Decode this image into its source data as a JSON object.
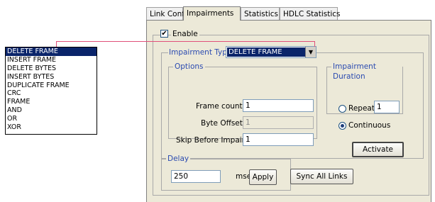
{
  "tabs": [
    "Link Config",
    "Impairments",
    "Statistics",
    "HDLC Statistics"
  ],
  "active_tab": "Impairments",
  "enable": {
    "label": "Enable",
    "checked": true
  },
  "impairment_type": {
    "label": "Impairment Type",
    "value": "DELETE FRAME"
  },
  "options": {
    "title": "Options",
    "frame_count": {
      "label": "Frame count",
      "value": "1"
    },
    "byte_offset": {
      "label": "Byte Offset",
      "value": "1"
    },
    "skip_before": {
      "label": "Skip Before Impair",
      "value": "1"
    }
  },
  "duration": {
    "title": "Impairment Duration",
    "repeat": {
      "label": "Repeat",
      "value": "1"
    },
    "continuous": {
      "label": "Continuous"
    },
    "selected": "Continuous",
    "activate_label": "Activate"
  },
  "delay": {
    "title": "Delay",
    "value": "250",
    "unit": "msec",
    "apply_label": "Apply",
    "sync_label": "Sync All Links"
  },
  "dropdown_options": [
    "DELETE FRAME",
    "INSERT FRAME",
    "DELETE BYTES",
    "INSERT BYTES",
    "DUPLICATE FRAME",
    "CRC",
    "FRAME",
    "AND",
    "OR",
    "XOR"
  ],
  "colors": {
    "highlight": "#0a246a",
    "connector": "#e0507a",
    "group_title": "#2a4ab0"
  }
}
